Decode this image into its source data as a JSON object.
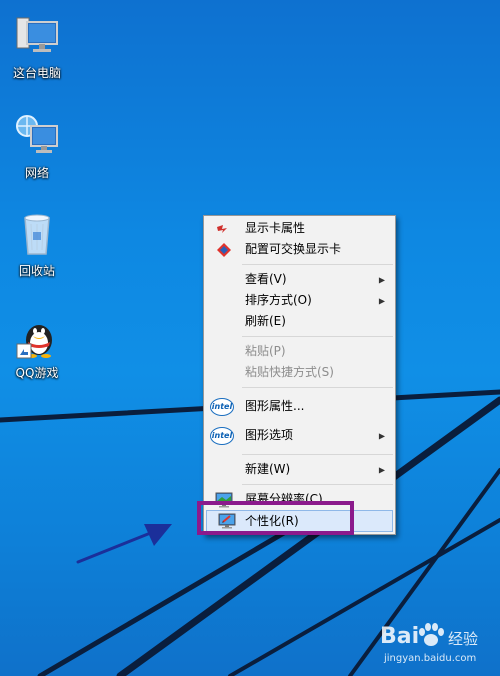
{
  "desktop": {
    "icons": [
      {
        "label": "这台电脑",
        "icon": "computer-icon"
      },
      {
        "label": "网络",
        "icon": "network-icon"
      },
      {
        "label": "回收站",
        "icon": "recycle-bin-icon"
      },
      {
        "label": "QQ游戏",
        "icon": "qq-game-icon"
      }
    ]
  },
  "context_menu": {
    "groups": [
      [
        {
          "label": "显示卡属性",
          "icon": "display-card-icon"
        },
        {
          "label": "配置可交换显示卡",
          "icon": "switchable-graphics-icon"
        }
      ],
      [
        {
          "label": "查看(V)",
          "submenu": true
        },
        {
          "label": "排序方式(O)",
          "submenu": true
        },
        {
          "label": "刷新(E)"
        }
      ],
      [
        {
          "label": "粘贴(P)",
          "disabled": true
        },
        {
          "label": "粘贴快捷方式(S)",
          "disabled": true
        }
      ],
      [
        {
          "label": "图形属性...",
          "icon": "intel-icon"
        },
        {
          "label": "图形选项",
          "icon": "intel-icon",
          "submenu": true
        }
      ],
      [
        {
          "label": "新建(W)",
          "submenu": true
        }
      ],
      [
        {
          "label": "屏幕分辨率(C)",
          "icon": "screen-resolution-icon"
        },
        {
          "label": "个性化(R)",
          "icon": "personalize-icon",
          "highlighted": true
        }
      ]
    ],
    "intel_logo_text": "intel"
  },
  "annotations": {
    "highlight_color": "#8b1a8c",
    "arrow_color": "#1b2f9a"
  },
  "watermark": {
    "brand": "Bai",
    "brand_cn": "经验",
    "url": "jingyan.baidu.com"
  },
  "colors": {
    "desktop_blue": "#0a86e2",
    "menu_bg": "#f2f2f2",
    "menu_highlight": "#dbe9fb"
  }
}
